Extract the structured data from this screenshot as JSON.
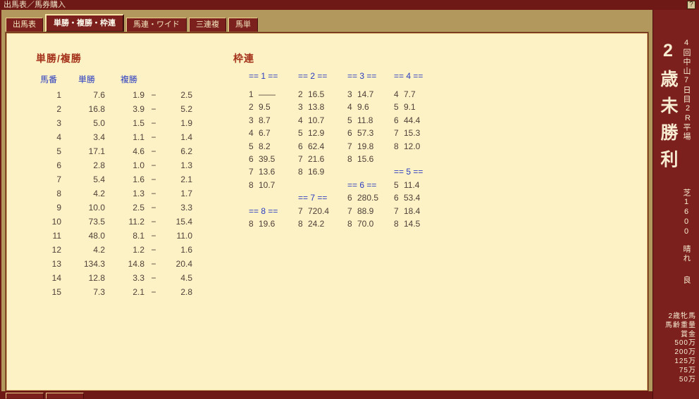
{
  "colors": {
    "maroon": "#7b201c",
    "title_maroon": "#6e1916",
    "frame_tan": "#b2985c",
    "panel_cream": "#fcf2c6",
    "header_blue": "#2b3cc0",
    "heading_red": "#a33018",
    "value_brown": "#4f4038",
    "tab_text": "#f3e4bc"
  },
  "title_bar": {
    "title": "出馬表／馬券購入",
    "help_label": "?"
  },
  "tabs": [
    {
      "name": "tab-racecard",
      "label": "出馬表",
      "active": false
    },
    {
      "name": "tab-win-place-bracket",
      "label": "単勝・複勝・枠連",
      "active": true
    },
    {
      "name": "tab-quinella-wide",
      "label": "馬連・ワイド",
      "active": false
    },
    {
      "name": "tab-trio",
      "label": "三連複",
      "active": false
    },
    {
      "name": "tab-exacta",
      "label": "馬単",
      "active": false
    }
  ],
  "tansho_fukusho": {
    "title": "単勝/複勝",
    "headers": {
      "number": "馬番",
      "win": "単勝",
      "place": "複勝"
    },
    "separator": "−",
    "rows": [
      {
        "num": "1",
        "win": "7.6",
        "low": "1.9",
        "high": "2.5"
      },
      {
        "num": "2",
        "win": "16.8",
        "low": "3.9",
        "high": "5.2"
      },
      {
        "num": "3",
        "win": "5.0",
        "low": "1.5",
        "high": "1.9"
      },
      {
        "num": "4",
        "win": "3.4",
        "low": "1.1",
        "high": "1.4"
      },
      {
        "num": "5",
        "win": "17.1",
        "low": "4.6",
        "high": "6.2"
      },
      {
        "num": "6",
        "win": "2.8",
        "low": "1.0",
        "high": "1.3"
      },
      {
        "num": "7",
        "win": "5.4",
        "low": "1.6",
        "high": "2.1"
      },
      {
        "num": "8",
        "win": "4.2",
        "low": "1.3",
        "high": "1.7"
      },
      {
        "num": "9",
        "win": "10.0",
        "low": "2.5",
        "high": "3.3"
      },
      {
        "num": "10",
        "win": "73.5",
        "low": "11.2",
        "high": "15.4"
      },
      {
        "num": "11",
        "win": "48.0",
        "low": "8.1",
        "high": "11.0"
      },
      {
        "num": "12",
        "win": "4.2",
        "low": "1.2",
        "high": "1.6"
      },
      {
        "num": "13",
        "win": "134.3",
        "low": "14.8",
        "high": "20.4"
      },
      {
        "num": "14",
        "win": "12.8",
        "low": "3.3",
        "high": "4.5"
      },
      {
        "num": "15",
        "win": "7.3",
        "low": "2.1",
        "high": "2.8"
      }
    ]
  },
  "wakuren": {
    "title": "枠連",
    "grid": [
      [
        {
          "h": "== 1 =="
        },
        {
          "h": "== 2 =="
        },
        {
          "h": "== 3 =="
        },
        {
          "h": "== 4 =="
        }
      ],
      [
        {
          "n": "1",
          "v": "――"
        },
        {
          "n": "2",
          "v": "16.5"
        },
        {
          "n": "3",
          "v": "14.7"
        },
        {
          "n": "4",
          "v": "7.7"
        }
      ],
      [
        {
          "n": "2",
          "v": "9.5"
        },
        {
          "n": "3",
          "v": "13.8"
        },
        {
          "n": "4",
          "v": "9.6"
        },
        {
          "n": "5",
          "v": "9.1"
        }
      ],
      [
        {
          "n": "3",
          "v": "8.7"
        },
        {
          "n": "4",
          "v": "10.7"
        },
        {
          "n": "5",
          "v": "11.8"
        },
        {
          "n": "6",
          "v": "44.4"
        }
      ],
      [
        {
          "n": "4",
          "v": "6.7"
        },
        {
          "n": "5",
          "v": "12.9"
        },
        {
          "n": "6",
          "v": "57.3"
        },
        {
          "n": "7",
          "v": "15.3"
        }
      ],
      [
        {
          "n": "5",
          "v": "8.2"
        },
        {
          "n": "6",
          "v": "62.4"
        },
        {
          "n": "7",
          "v": "19.8"
        },
        {
          "n": "8",
          "v": "12.0"
        }
      ],
      [
        {
          "n": "6",
          "v": "39.5"
        },
        {
          "n": "7",
          "v": "21.6"
        },
        {
          "n": "8",
          "v": "15.6"
        },
        null
      ],
      [
        {
          "n": "7",
          "v": "13.6"
        },
        {
          "n": "8",
          "v": "16.9"
        },
        null,
        {
          "h": "== 5 =="
        }
      ],
      [
        {
          "n": "8",
          "v": "10.7"
        },
        null,
        {
          "h": "== 6 =="
        },
        {
          "n": "5",
          "v": "11.4"
        }
      ],
      [
        null,
        {
          "h": "== 7 =="
        },
        {
          "n": "6",
          "v": "280.5"
        },
        {
          "n": "6",
          "v": "53.4"
        }
      ],
      [
        {
          "h": "== 8 =="
        },
        {
          "n": "7",
          "v": "720.4"
        },
        {
          "n": "7",
          "v": "88.9"
        },
        {
          "n": "7",
          "v": "18.4"
        }
      ],
      [
        {
          "n": "8",
          "v": "19.6"
        },
        {
          "n": "8",
          "v": "24.2"
        },
        {
          "n": "8",
          "v": "70.0"
        },
        {
          "n": "8",
          "v": "14.5"
        }
      ]
    ]
  },
  "sidebar": {
    "meet": "4回中山7日目",
    "race_no": "2R",
    "grade": "平場",
    "race_name": "2歳未勝利",
    "course": "芝1600",
    "weather": "晴れ",
    "going": "良",
    "conditions": [
      "2歳牝馬",
      "馬齢重量",
      "賞金",
      "500万",
      "200万",
      "125万",
      "75万",
      "50万"
    ]
  }
}
